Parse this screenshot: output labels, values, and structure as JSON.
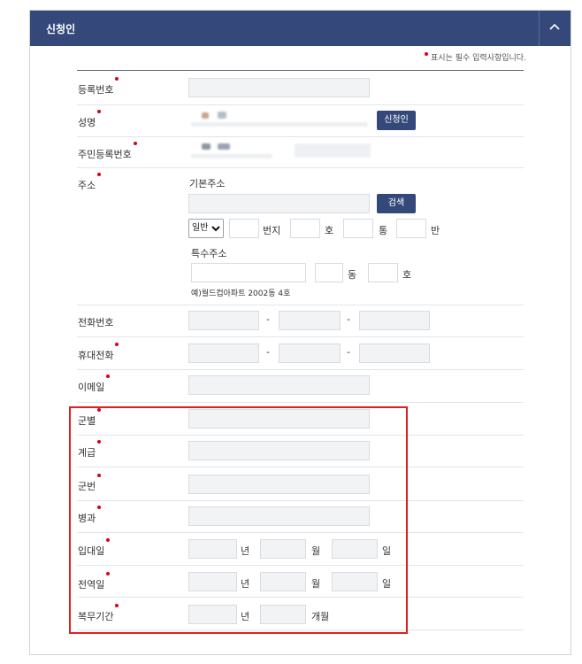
{
  "header": {
    "title": "신청인"
  },
  "required_note": "표시는 필수 입력사항입니다.",
  "fields": {
    "reg_no": "등록번호",
    "name": "성명",
    "resident_no": "주민등록번호",
    "address": "주소",
    "phone": "전화번호",
    "mobile": "휴대전화",
    "email": "이메일",
    "service_branch": "군별",
    "rank": "계급",
    "service_no": "군번",
    "specialty": "병과",
    "enlist_date": "입대일",
    "discharge_date": "전역일",
    "service_period": "복무기간"
  },
  "buttons": {
    "applicant": "신청인",
    "search": "검색"
  },
  "address": {
    "basic": "기본주소",
    "special": "특수주소",
    "select_value": "일반",
    "unit_bunji": "번지",
    "unit_ho": "호",
    "unit_tong": "통",
    "unit_ban": "반",
    "unit_dong": "동",
    "unit_ho2": "호",
    "example": "예)월드컵아파트 2002동 4호"
  },
  "dash": "-",
  "units": {
    "year": "년",
    "month": "월",
    "day": "일",
    "months": "개월"
  }
}
